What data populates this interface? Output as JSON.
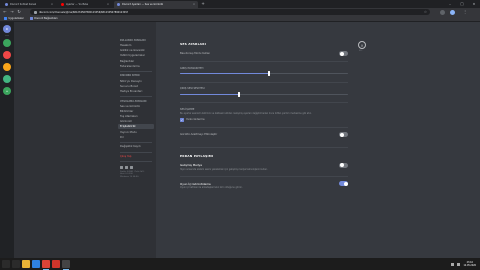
{
  "browser": {
    "tabs": [
      {
        "title": "Discord Sohbet Kanalı",
        "favicon_color": "#7289da",
        "active": false
      },
      {
        "title": "Ayarlar — YouTube",
        "favicon_color": "#ff0000",
        "active": false
      },
      {
        "title": "Discord Ayarları — Ses ve Görüntü",
        "favicon_color": "#7289da",
        "active": true
      }
    ],
    "url": "discord.com/channels/@me/681234567890123456/681234567890123457",
    "bookmarks": [
      {
        "label": "Uygulamalar",
        "color": "#4285f4"
      },
      {
        "label": "Discord Bağlantıları",
        "color": "#7289da"
      }
    ]
  },
  "guilds": [
    {
      "label": "D",
      "color": "#7289da"
    },
    {
      "label": "",
      "color": "#3ba55d"
    },
    {
      "label": "",
      "color": "#f04747"
    },
    {
      "label": "",
      "color": "#faa61a"
    },
    {
      "label": "",
      "color": "#43b581"
    },
    {
      "label": "",
      "color": "#3ba55d"
    }
  ],
  "sidebar": {
    "sections": [
      {
        "header": "Kullanıcı Ayarları",
        "items": [
          "Hesabım",
          "Gizlilik ve Güvenlik",
          "Yetkili Uygulamalar",
          "Bağlantılar",
          "Faturalandırma"
        ]
      },
      {
        "header": "Discord Nitro",
        "items": [
          "Nitro'yu Deneyin",
          "Sunucu Boost",
          "Hediye Envanteri"
        ]
      },
      {
        "header": "Uygulama Ayarları",
        "items": [
          "Ses ve Görüntü",
          "Bildirimler",
          "Tuş Atamaları",
          "Görünüm",
          "Erişilebilirlik",
          "Yayıncı Modu",
          "Dil"
        ]
      }
    ],
    "whats_new": "Değişiklik Kaydı",
    "logout": "Çıkış Yap",
    "version_lines": [
      "Stable 52842 (7e6c1b9)",
      "Host 0.0.306",
      "Windows 10 64-Bit"
    ],
    "selected": "Bildirimler"
  },
  "main": {
    "close_label": "ESC",
    "section1": {
      "title": "Ses Ayarları",
      "push_to_talk": "Bas-Konuş Modu Kullan",
      "sensitivity_caption": "Giriş Hassasiyeti",
      "sensitivity_value": 0.53,
      "volume_caption": "Çıkış Sesi Seviyesi",
      "volume_value": 0.35,
      "note_caption": "Ses İşleme",
      "note_text": "Bu ayarlar sesinizin iletimini ve kalitesini etkiler. Gelişmiş ayarları değiştirmeden önce lütfen yardım merkezine göz atın.",
      "checkbox_label": "Yankı Giderme",
      "noise_label": "Gürültü Azaltmayı Etkinleştir"
    },
    "section2": {
      "title": "Ekran Paylaşımı",
      "stream_label": "Gelişmiş Medya",
      "stream_desc": "Yayın sırasında sistem sesini yakalamak için gelişmiş medya teknolojisini kullan.",
      "stream_on": false,
      "overlay_label": "Oyun İçi Görüntüleme",
      "overlay_desc": "Oyun içi katman ile arkadaşlarınızın kim olduğunu görün.",
      "overlay_on": true
    }
  },
  "taskbar": {
    "apps": [
      {
        "name": "start",
        "color": "#2b2b2b"
      },
      {
        "name": "search",
        "color": "#2b2b2b"
      },
      {
        "name": "explorer",
        "color": "#e8b337"
      },
      {
        "name": "edge",
        "color": "#2f82e3"
      },
      {
        "name": "chrome",
        "color": "#db4437"
      },
      {
        "name": "opera",
        "color": "#d1352b"
      },
      {
        "name": "terminal",
        "color": "#444444"
      }
    ],
    "time": "23:16",
    "date": "12.05.2020"
  },
  "colors": {
    "accent": "#7289da",
    "background": "#36393f",
    "sidebar": "#2f3136"
  }
}
